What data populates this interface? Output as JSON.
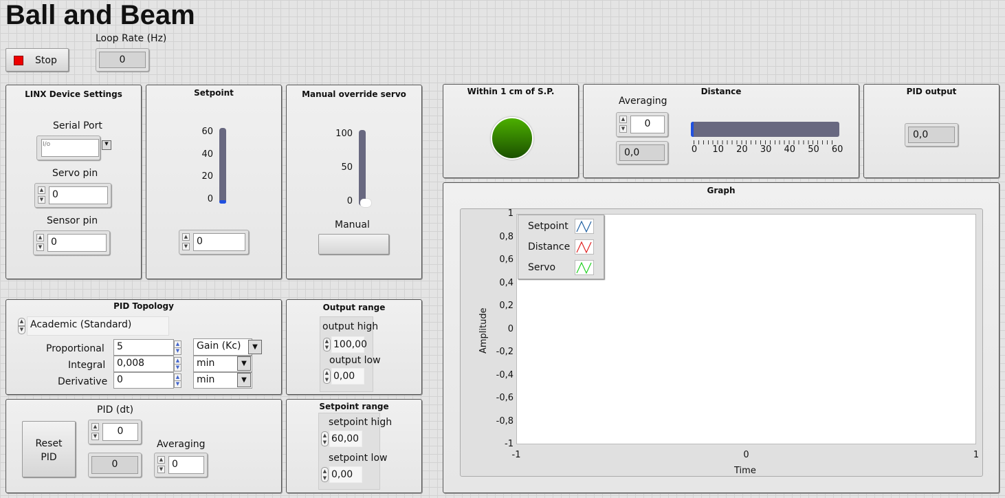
{
  "title": "Ball and Beam",
  "stop": {
    "label": "Stop",
    "color": "#ee0000"
  },
  "loop_rate": {
    "label": "Loop Rate (Hz)",
    "value": "0"
  },
  "linx": {
    "title": "LINX Device Settings",
    "serial_port_label": "Serial Port",
    "serial_port_value": "",
    "servo_pin_label": "Servo pin",
    "servo_pin_value": "0",
    "sensor_pin_label": "Sensor pin",
    "sensor_pin_value": "0"
  },
  "setpoint": {
    "title": "Setpoint",
    "ticks": [
      "60",
      "40",
      "20",
      "0"
    ],
    "value": "0",
    "scale_max": 60,
    "level": 0
  },
  "manual": {
    "title": "Manual override servo",
    "ticks": [
      "100",
      "50",
      "0"
    ],
    "level": 0,
    "button_label": "Manual"
  },
  "pid_topology": {
    "title": "PID Topology",
    "topology": "Academic (Standard)",
    "rows": [
      {
        "label": "Proportional",
        "value": "5",
        "unit": "Gain (Kc)"
      },
      {
        "label": "Integral",
        "value": "0,008",
        "unit": "min"
      },
      {
        "label": "Derivative",
        "value": "0",
        "unit": "min"
      }
    ]
  },
  "output_range": {
    "title": "Output range",
    "high_label": "output high",
    "high_value": "100,00",
    "low_label": "output low",
    "low_value": "0,00"
  },
  "pid_dt": {
    "reset_label_1": "Reset",
    "reset_label_2": "PID",
    "dt_label": "PID (dt)",
    "dt_value": "0",
    "dt_indicator": "0",
    "averaging_label": "Averaging",
    "averaging_value": "0"
  },
  "setpoint_range": {
    "title": "Setpoint range",
    "high_label": "setpoint high",
    "high_value": "60,00",
    "low_label": "setpoint low",
    "low_value": "0,00"
  },
  "within": {
    "title": "Within 1 cm of S.P.",
    "led_on": true,
    "led_color": "#2e8b00"
  },
  "distance": {
    "title": "Distance",
    "averaging_label": "Averaging",
    "averaging_value": "0",
    "value": "0,0",
    "bar_level": 0,
    "bar_ticks": [
      "0",
      "10",
      "20",
      "30",
      "40",
      "50",
      "60"
    ]
  },
  "pid_output": {
    "title": "PID output",
    "value": "0,0"
  },
  "graph": {
    "title": "Graph",
    "ylabel": "Amplitude",
    "xlabel": "Time",
    "yticks": [
      "1",
      "0,8",
      "0,6",
      "0,4",
      "0,2",
      "0",
      "-0,2",
      "-0,4",
      "-0,6",
      "-0,8",
      "-1"
    ],
    "xticks": [
      "-1",
      "0",
      "1"
    ],
    "legend": [
      {
        "name": "Setpoint",
        "color": "#1f5fa0"
      },
      {
        "name": "Distance",
        "color": "#e02020"
      },
      {
        "name": "Servo",
        "color": "#20d020"
      }
    ]
  }
}
